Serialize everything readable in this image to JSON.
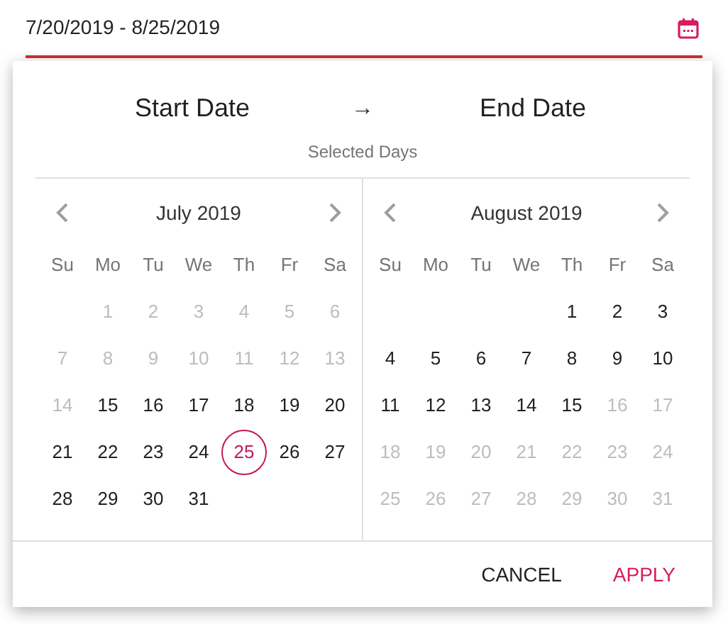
{
  "field": {
    "value": "7/20/2019 - 8/25/2019"
  },
  "header": {
    "start": "Start Date",
    "arrow": "→",
    "end": "End Date",
    "caption": "Selected Days"
  },
  "calendars": [
    {
      "month": "July 2019",
      "weekdays": [
        "Su",
        "Mo",
        "Tu",
        "We",
        "Th",
        "Fr",
        "Sa"
      ],
      "days": [
        {
          "kind": "blank"
        },
        {
          "kind": "day",
          "label": "1",
          "disabled": true,
          "selected": false
        },
        {
          "kind": "day",
          "label": "2",
          "disabled": true,
          "selected": false
        },
        {
          "kind": "day",
          "label": "3",
          "disabled": true,
          "selected": false
        },
        {
          "kind": "day",
          "label": "4",
          "disabled": true,
          "selected": false
        },
        {
          "kind": "day",
          "label": "5",
          "disabled": true,
          "selected": false
        },
        {
          "kind": "day",
          "label": "6",
          "disabled": true,
          "selected": false
        },
        {
          "kind": "day",
          "label": "7",
          "disabled": true,
          "selected": false
        },
        {
          "kind": "day",
          "label": "8",
          "disabled": true,
          "selected": false
        },
        {
          "kind": "day",
          "label": "9",
          "disabled": true,
          "selected": false
        },
        {
          "kind": "day",
          "label": "10",
          "disabled": true,
          "selected": false
        },
        {
          "kind": "day",
          "label": "11",
          "disabled": true,
          "selected": false
        },
        {
          "kind": "day",
          "label": "12",
          "disabled": true,
          "selected": false
        },
        {
          "kind": "day",
          "label": "13",
          "disabled": true,
          "selected": false
        },
        {
          "kind": "day",
          "label": "14",
          "disabled": true,
          "selected": false
        },
        {
          "kind": "day",
          "label": "15",
          "disabled": false,
          "selected": false
        },
        {
          "kind": "day",
          "label": "16",
          "disabled": false,
          "selected": false
        },
        {
          "kind": "day",
          "label": "17",
          "disabled": false,
          "selected": false
        },
        {
          "kind": "day",
          "label": "18",
          "disabled": false,
          "selected": false
        },
        {
          "kind": "day",
          "label": "19",
          "disabled": false,
          "selected": false
        },
        {
          "kind": "day",
          "label": "20",
          "disabled": false,
          "selected": false
        },
        {
          "kind": "day",
          "label": "21",
          "disabled": false,
          "selected": false
        },
        {
          "kind": "day",
          "label": "22",
          "disabled": false,
          "selected": false
        },
        {
          "kind": "day",
          "label": "23",
          "disabled": false,
          "selected": false
        },
        {
          "kind": "day",
          "label": "24",
          "disabled": false,
          "selected": false
        },
        {
          "kind": "day",
          "label": "25",
          "disabled": false,
          "selected": true
        },
        {
          "kind": "day",
          "label": "26",
          "disabled": false,
          "selected": false
        },
        {
          "kind": "day",
          "label": "27",
          "disabled": false,
          "selected": false
        },
        {
          "kind": "day",
          "label": "28",
          "disabled": false,
          "selected": false
        },
        {
          "kind": "day",
          "label": "29",
          "disabled": false,
          "selected": false
        },
        {
          "kind": "day",
          "label": "30",
          "disabled": false,
          "selected": false
        },
        {
          "kind": "day",
          "label": "31",
          "disabled": false,
          "selected": false
        }
      ]
    },
    {
      "month": "August 2019",
      "weekdays": [
        "Su",
        "Mo",
        "Tu",
        "We",
        "Th",
        "Fr",
        "Sa"
      ],
      "days": [
        {
          "kind": "blank"
        },
        {
          "kind": "blank"
        },
        {
          "kind": "blank"
        },
        {
          "kind": "blank"
        },
        {
          "kind": "day",
          "label": "1",
          "disabled": false,
          "selected": false
        },
        {
          "kind": "day",
          "label": "2",
          "disabled": false,
          "selected": false
        },
        {
          "kind": "day",
          "label": "3",
          "disabled": false,
          "selected": false
        },
        {
          "kind": "day",
          "label": "4",
          "disabled": false,
          "selected": false
        },
        {
          "kind": "day",
          "label": "5",
          "disabled": false,
          "selected": false
        },
        {
          "kind": "day",
          "label": "6",
          "disabled": false,
          "selected": false
        },
        {
          "kind": "day",
          "label": "7",
          "disabled": false,
          "selected": false
        },
        {
          "kind": "day",
          "label": "8",
          "disabled": false,
          "selected": false
        },
        {
          "kind": "day",
          "label": "9",
          "disabled": false,
          "selected": false
        },
        {
          "kind": "day",
          "label": "10",
          "disabled": false,
          "selected": false
        },
        {
          "kind": "day",
          "label": "11",
          "disabled": false,
          "selected": false
        },
        {
          "kind": "day",
          "label": "12",
          "disabled": false,
          "selected": false
        },
        {
          "kind": "day",
          "label": "13",
          "disabled": false,
          "selected": false
        },
        {
          "kind": "day",
          "label": "14",
          "disabled": false,
          "selected": false
        },
        {
          "kind": "day",
          "label": "15",
          "disabled": false,
          "selected": false
        },
        {
          "kind": "day",
          "label": "16",
          "disabled": true,
          "selected": false
        },
        {
          "kind": "day",
          "label": "17",
          "disabled": true,
          "selected": false
        },
        {
          "kind": "day",
          "label": "18",
          "disabled": true,
          "selected": false
        },
        {
          "kind": "day",
          "label": "19",
          "disabled": true,
          "selected": false
        },
        {
          "kind": "day",
          "label": "20",
          "disabled": true,
          "selected": false
        },
        {
          "kind": "day",
          "label": "21",
          "disabled": true,
          "selected": false
        },
        {
          "kind": "day",
          "label": "22",
          "disabled": true,
          "selected": false
        },
        {
          "kind": "day",
          "label": "23",
          "disabled": true,
          "selected": false
        },
        {
          "kind": "day",
          "label": "24",
          "disabled": true,
          "selected": false
        },
        {
          "kind": "day",
          "label": "25",
          "disabled": true,
          "selected": false
        },
        {
          "kind": "day",
          "label": "26",
          "disabled": true,
          "selected": false
        },
        {
          "kind": "day",
          "label": "27",
          "disabled": true,
          "selected": false
        },
        {
          "kind": "day",
          "label": "28",
          "disabled": true,
          "selected": false
        },
        {
          "kind": "day",
          "label": "29",
          "disabled": true,
          "selected": false
        },
        {
          "kind": "day",
          "label": "30",
          "disabled": true,
          "selected": false
        },
        {
          "kind": "day",
          "label": "31",
          "disabled": true,
          "selected": false
        }
      ]
    }
  ],
  "buttons": [
    {
      "label": "CANCEL",
      "kind": "secondary"
    },
    {
      "label": "APPLY",
      "kind": "primary"
    }
  ]
}
